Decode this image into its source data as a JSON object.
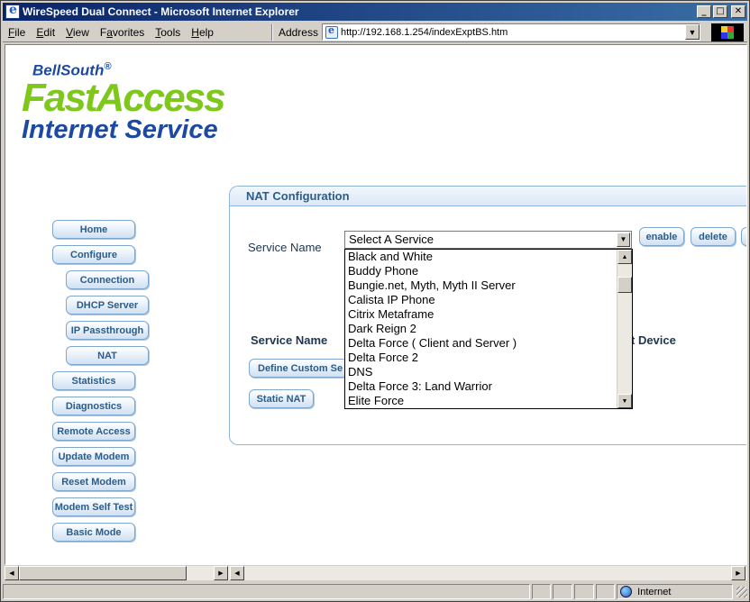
{
  "window": {
    "title": "WireSpeed Dual Connect - Microsoft Internet Explorer",
    "controls": [
      "_",
      "□",
      "✕"
    ]
  },
  "menu": {
    "items": [
      {
        "pre": "",
        "key": "F",
        "post": "ile"
      },
      {
        "pre": "",
        "key": "E",
        "post": "dit"
      },
      {
        "pre": "",
        "key": "V",
        "post": "iew"
      },
      {
        "pre": "F",
        "key": "a",
        "post": "vorites"
      },
      {
        "pre": "",
        "key": "T",
        "post": "ools"
      },
      {
        "pre": "",
        "key": "H",
        "post": "elp"
      }
    ]
  },
  "address": {
    "label": "Address",
    "url": "http://192.168.1.254/indexExptBS.htm"
  },
  "logo": {
    "bellsouth": "BellSouth",
    "reg": "®",
    "fastaccess": "FastAccess",
    "internet_service": "Internet Service"
  },
  "nav": {
    "home": "Home",
    "configure": "Configure",
    "connection": "Connection",
    "dhcp": "DHCP Server",
    "passthrough": "IP Passthrough",
    "nat": "NAT",
    "statistics": "Statistics",
    "diagnostics": "Diagnostics",
    "remote_access": "Remote Access",
    "update_modem": "Update Modem",
    "reset_modem": "Reset Modem",
    "self_test": "Modem Self Test",
    "basic_mode": "Basic Mode"
  },
  "panel": {
    "title": "NAT Configuration",
    "service_label": "Service Name",
    "selected": "Select A Service",
    "enable": "enable",
    "delete": "delete",
    "col_service": "Service Name",
    "col_device": "t Device",
    "define_custom": "Define Custom Se",
    "static_nat": "Static NAT"
  },
  "services": [
    "Black and White",
    "Buddy Phone",
    "Bungie.net, Myth, Myth II Server",
    "Calista IP Phone",
    "Citrix Metaframe",
    "Dark Reign 2",
    "Delta Force ( Client and Server )",
    "Delta Force 2",
    "DNS",
    "Delta Force 3: Land Warrior",
    "Elite Force"
  ],
  "status": {
    "zone": "Internet"
  }
}
